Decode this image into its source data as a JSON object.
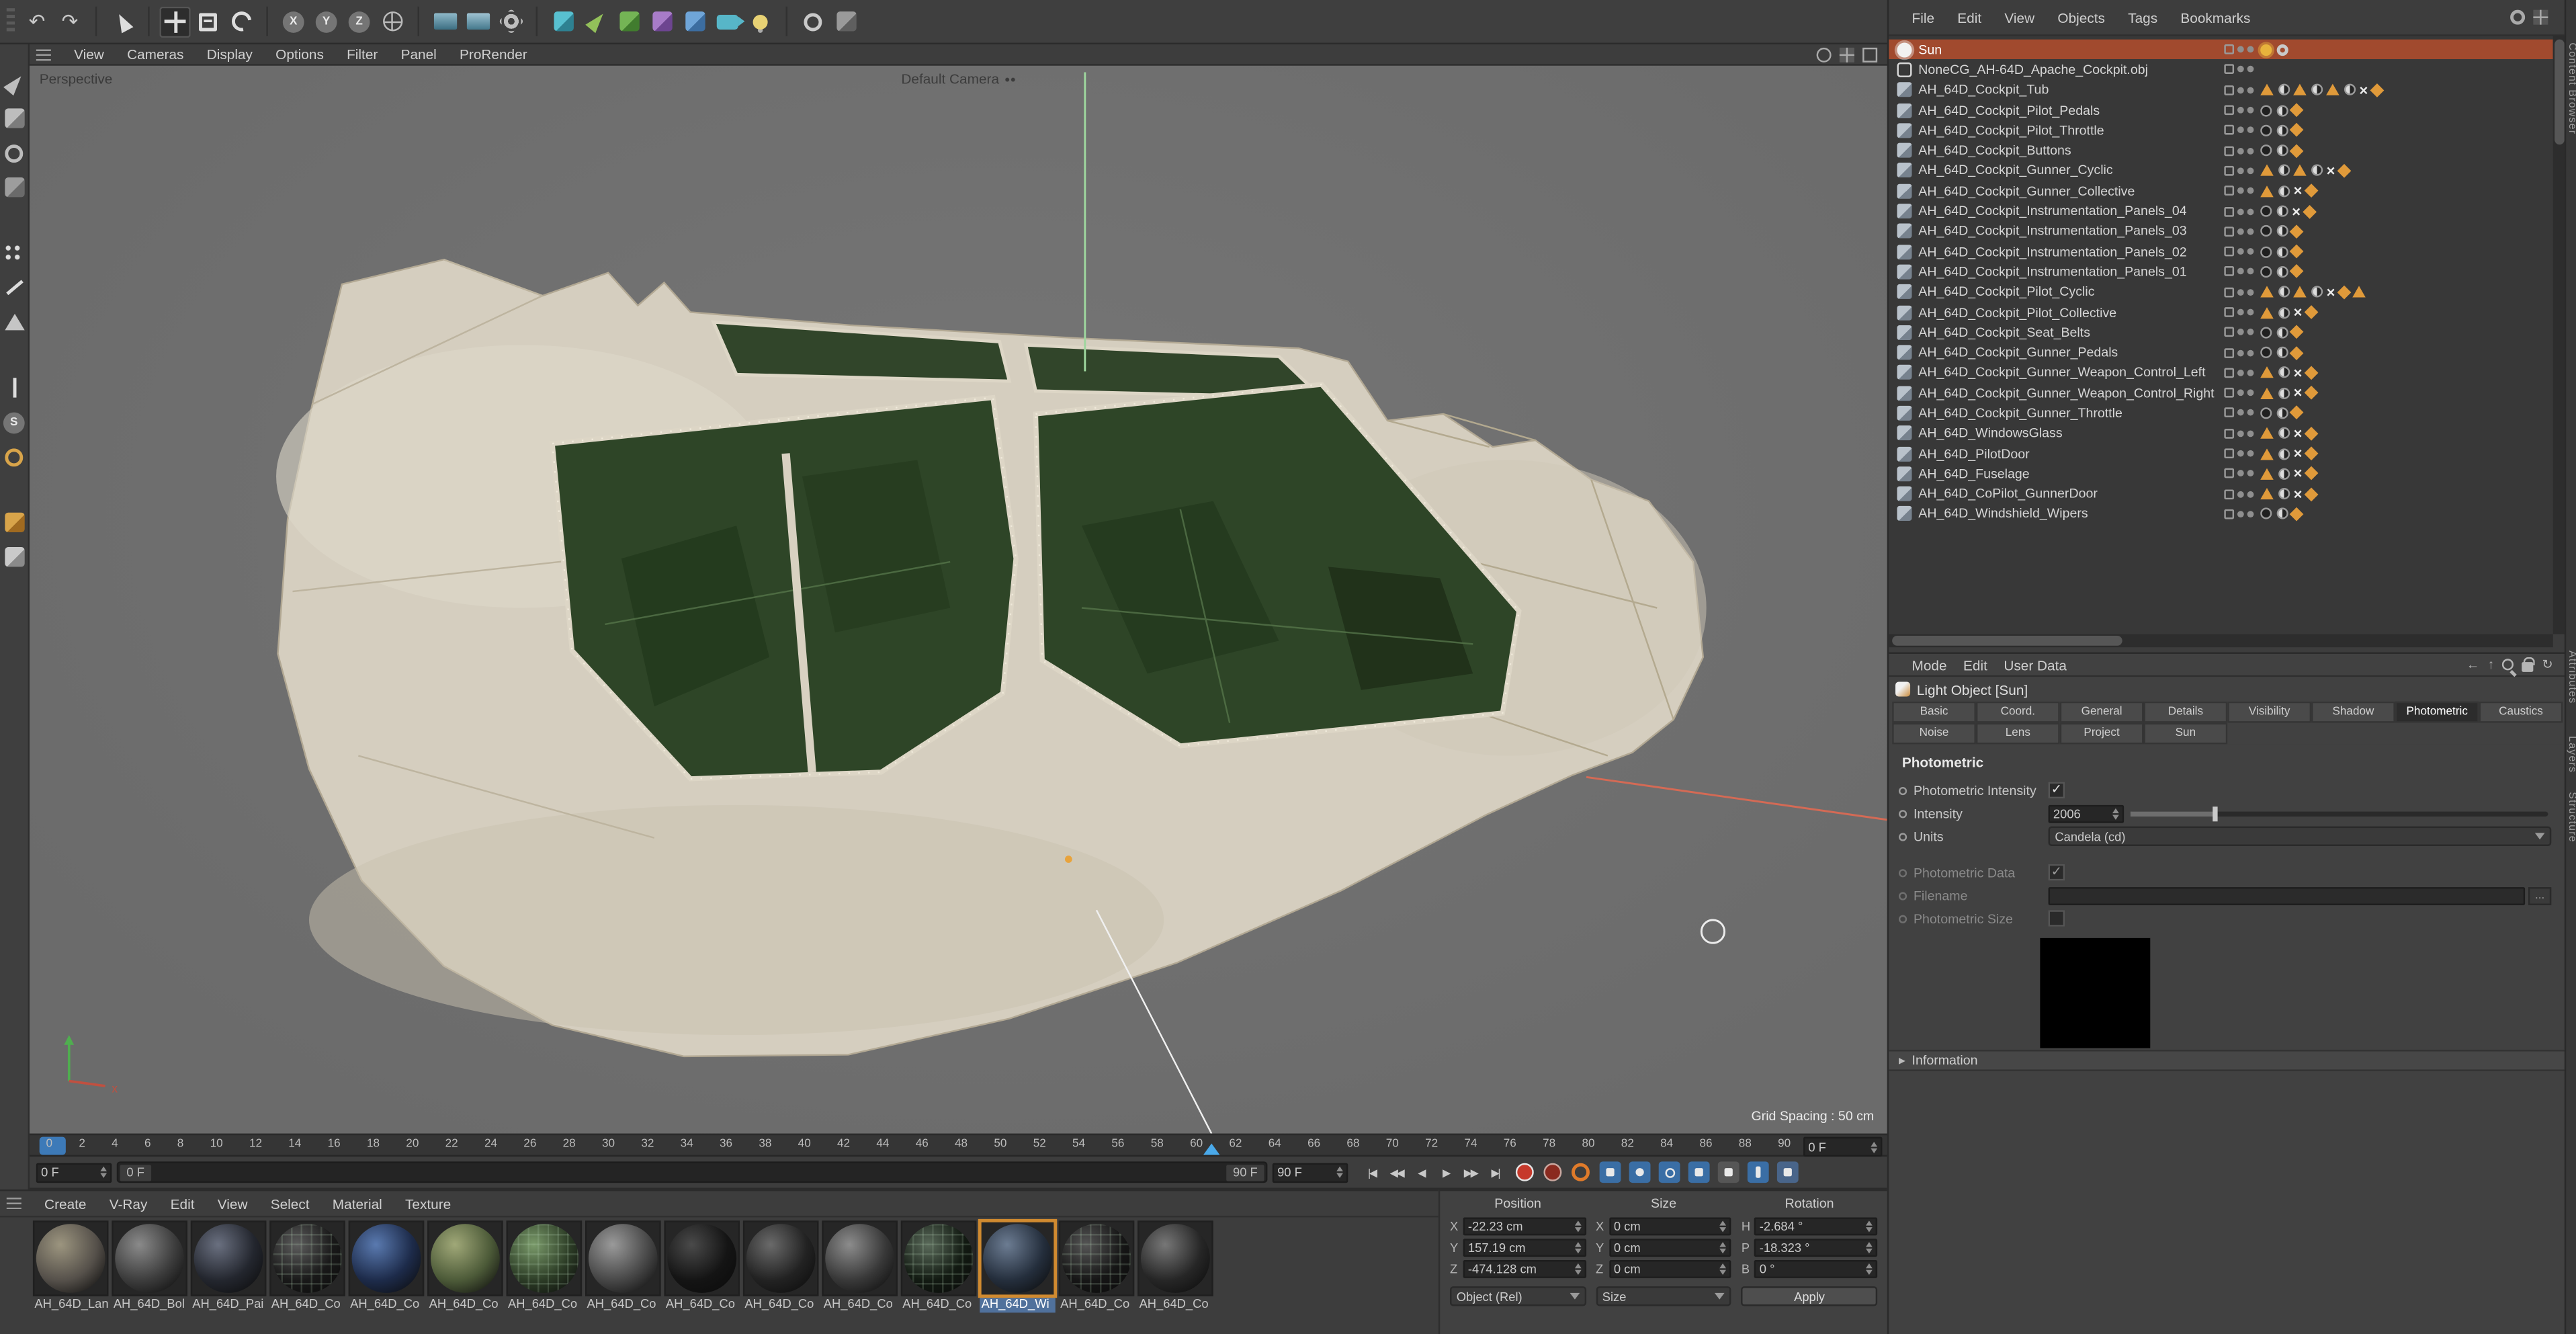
{
  "toolbar": {
    "icons": [
      {
        "name": "undo-icon",
        "type": "glyph",
        "glyph": "↶"
      },
      {
        "name": "redo-icon",
        "type": "glyph",
        "glyph": "↷"
      },
      {
        "sep": true
      },
      {
        "name": "live-selection-icon",
        "type": "cursor"
      },
      {
        "sep": true
      },
      {
        "name": "move-tool-icon",
        "type": "move",
        "active": true
      },
      {
        "name": "scale-tool-icon",
        "type": "scale"
      },
      {
        "name": "rotate-tool-icon",
        "type": "rotate"
      },
      {
        "sep": true
      },
      {
        "name": "x-axis-lock-icon",
        "type": "axis",
        "glyph": "X"
      },
      {
        "name": "y-axis-lock-icon",
        "type": "axis",
        "glyph": "Y"
      },
      {
        "name": "z-axis-lock-icon",
        "type": "axis",
        "glyph": "Z"
      },
      {
        "name": "coordinate-system-icon",
        "type": "coord"
      },
      {
        "sep": true
      },
      {
        "name": "render-view-icon",
        "type": "render",
        "c1": "#8fb9c9",
        "c2": "#3c6e82"
      },
      {
        "name": "render-picture-viewer-icon",
        "type": "render",
        "c1": "#9fc3d2",
        "c2": "#44788c"
      },
      {
        "name": "render-settings-icon",
        "type": "gear"
      },
      {
        "sep": true
      },
      {
        "name": "add-cube-icon",
        "type": "cube",
        "c1": "#58c0d0",
        "c2": "#2e8191"
      },
      {
        "name": "add-spline-icon",
        "type": "pen",
        "c1": "#93c05a"
      },
      {
        "name": "add-generator-icon",
        "type": "cube",
        "c1": "#74b455",
        "c2": "#417c2e"
      },
      {
        "name": "add-deformer-icon",
        "type": "cube",
        "c1": "#a87cc8",
        "c2": "#6d4590"
      },
      {
        "name": "add-environment-icon",
        "type": "cube",
        "c1": "#6fa5d8",
        "c2": "#3c6da0"
      },
      {
        "name": "add-camera-icon",
        "type": "cam",
        "c1": "#57b6c8"
      },
      {
        "name": "add-light-icon",
        "type": "bulb",
        "c1": "#e8d274"
      },
      {
        "sep": true
      },
      {
        "name": "snap-icon",
        "type": "ring",
        "c1": "#c9c9c9"
      },
      {
        "name": "workplane-icon",
        "type": "cube",
        "c1": "#9a9a9a",
        "c2": "#5f5f5f"
      }
    ]
  },
  "left_toolbar": {
    "icons": [
      {
        "name": "make-editable-icon",
        "type": "pen",
        "c1": "#bdbdbd"
      },
      {
        "name": "model-mode-icon",
        "type": "cube",
        "c1": "#bdbdbd",
        "c2": "#7c7c7c"
      },
      {
        "name": "texture-mode-icon",
        "type": "ring",
        "c1": "#bdbdbd"
      },
      {
        "name": "workplane-mode-icon",
        "type": "cube",
        "c1": "#9d9d9d",
        "c2": "#6a6a6a"
      },
      {
        "gap": true
      },
      {
        "name": "points-mode-icon",
        "type": "dots"
      },
      {
        "name": "edges-mode-icon",
        "type": "edge"
      },
      {
        "name": "polygons-mode-icon",
        "type": "poly"
      },
      {
        "gap": true
      },
      {
        "name": "enable-axis-icon",
        "type": "axisArrow"
      },
      {
        "name": "sds-weight-icon",
        "type": "axis",
        "glyph": "S"
      },
      {
        "name": "snap-toggle-icon",
        "type": "ring",
        "c1": "#d8a44a"
      },
      {
        "gap": true
      },
      {
        "name": "locked-workplane-icon",
        "type": "cube",
        "c1": "#d8a44a",
        "c2": "#a06a20"
      },
      {
        "name": "quantize-icon",
        "type": "cube",
        "c1": "#c9c9c9",
        "c2": "#8a8a8a"
      }
    ]
  },
  "viewport": {
    "label": "Perspective",
    "camera_label": "Default Camera",
    "grid_spacing": "Grid Spacing : 50 cm",
    "menu": [
      "View",
      "Cameras",
      "Display",
      "Options",
      "Filter",
      "Panel",
      "ProRender"
    ]
  },
  "timeline": {
    "ticks": [
      "0",
      "2",
      "4",
      "6",
      "8",
      "10",
      "12",
      "14",
      "16",
      "18",
      "20",
      "22",
      "24",
      "26",
      "28",
      "30",
      "32",
      "34",
      "36",
      "38",
      "40",
      "42",
      "44",
      "46",
      "48",
      "50",
      "52",
      "54",
      "56",
      "58",
      "60",
      "62",
      "64",
      "66",
      "68",
      "70",
      "72",
      "74",
      "76",
      "78",
      "80",
      "82",
      "84",
      "86",
      "88",
      "90"
    ],
    "ruler_current": "0 F",
    "current": "0 F",
    "range_start": "0 F",
    "range_end": "90 F",
    "end": "90 F",
    "transport_buttons": [
      {
        "name": "goto-start-button",
        "glyph": "|◀"
      },
      {
        "name": "prev-key-button",
        "glyph": "◀◀"
      },
      {
        "name": "prev-frame-button",
        "glyph": "◀"
      },
      {
        "name": "play-button",
        "glyph": "▶"
      },
      {
        "name": "next-key-button",
        "glyph": "▶▶"
      },
      {
        "name": "goto-end-button",
        "glyph": "▶|"
      }
    ]
  },
  "materials": {
    "menu": [
      "Create",
      "V-Ray",
      "Edit",
      "View",
      "Select",
      "Material",
      "Texture"
    ],
    "items": [
      {
        "label": "AH_64D_Lan",
        "hi": "#9c957f",
        "base": "#55504a"
      },
      {
        "label": "AH_64D_Bol",
        "hi": "#8a8a8a",
        "base": "#3c3c3c"
      },
      {
        "label": "AH_64D_Pai",
        "hi": "#6a7080",
        "base": "#23262e"
      },
      {
        "label": "AH_64D_Co",
        "hi": "#5c5c5c",
        "base": "#191919",
        "grid": true
      },
      {
        "label": "AH_64D_Co",
        "hi": "#5a7ab0",
        "base": "#1d2b4a"
      },
      {
        "label": "AH_64D_Co",
        "hi": "#a0a878",
        "base": "#4c5a38"
      },
      {
        "label": "AH_64D_Co",
        "hi": "#7a9a6a",
        "base": "#2c3c26",
        "grid": true
      },
      {
        "label": "AH_64D_Co",
        "hi": "#9a9a9a",
        "base": "#474747"
      },
      {
        "label": "AH_64D_Co",
        "hi": "#4a4a4a",
        "base": "#141414"
      },
      {
        "label": "AH_64D_Co",
        "hi": "#6a6a6a",
        "base": "#222222"
      },
      {
        "label": "AH_64D_Co",
        "hi": "#8c8c8c",
        "base": "#383838"
      },
      {
        "label": "AH_64D_Co",
        "hi": "#5a6a5a",
        "base": "#121a12",
        "grid": true
      },
      {
        "label": "AH_64D_Wi",
        "hi": "#6c7c92",
        "base": "#242e3c",
        "selected": true
      },
      {
        "label": "AH_64D_Co",
        "hi": "#555555",
        "base": "#161616",
        "grid": true
      },
      {
        "label": "AH_64D_Co",
        "hi": "#777777",
        "base": "#262626"
      }
    ]
  },
  "coordinates": {
    "columns": [
      {
        "header": "Position",
        "rows": [
          {
            "axis": "X",
            "value": "-22.23 cm"
          },
          {
            "axis": "Y",
            "value": "157.19 cm"
          },
          {
            "axis": "Z",
            "value": "-474.128 cm"
          }
        ],
        "footer": {
          "type": "dropdown",
          "label": "Object (Rel)"
        }
      },
      {
        "header": "Size",
        "rows": [
          {
            "axis": "X",
            "value": "0 cm"
          },
          {
            "axis": "Y",
            "value": "0 cm"
          },
          {
            "axis": "Z",
            "value": "0 cm"
          }
        ],
        "footer": {
          "type": "dropdown",
          "label": "Size"
        }
      },
      {
        "header": "Rotation",
        "rows": [
          {
            "axis": "H",
            "value": "-2.684 °"
          },
          {
            "axis": "P",
            "value": "-18.323 °"
          },
          {
            "axis": "B",
            "value": "0 °"
          }
        ],
        "footer": {
          "type": "button",
          "label": "Apply"
        }
      }
    ]
  },
  "object_manager": {
    "menu": [
      "File",
      "Edit",
      "View",
      "Objects",
      "Tags",
      "Bookmarks"
    ],
    "rows": [
      {
        "name": "Sun",
        "icon": "light",
        "selected": true,
        "tags": [
          "sun",
          "gear"
        ]
      },
      {
        "name": "NoneCG_AH-64D_Apache_Cockpit.obj",
        "icon": "null",
        "tags": []
      },
      {
        "name": "AH_64D_Cockpit_Tub",
        "icon": "mesh",
        "tags": [
          "tri",
          "half",
          "tri",
          "half",
          "tri",
          "half",
          "x",
          "star"
        ]
      },
      {
        "name": "AH_64D_Cockpit_Pilot_Pedals",
        "icon": "mesh",
        "tags": [
          "circle",
          "half",
          "star"
        ]
      },
      {
        "name": "AH_64D_Cockpit_Pilot_Throttle",
        "icon": "mesh",
        "tags": [
          "circle",
          "half",
          "star"
        ]
      },
      {
        "name": "AH_64D_Cockpit_Buttons",
        "icon": "mesh",
        "tags": [
          "circle",
          "half",
          "star"
        ]
      },
      {
        "name": "AH_64D_Cockpit_Gunner_Cyclic",
        "icon": "mesh",
        "tags": [
          "tri",
          "half",
          "tri",
          "half",
          "x",
          "star"
        ]
      },
      {
        "name": "AH_64D_Cockpit_Gunner_Collective",
        "icon": "mesh",
        "tags": [
          "tri",
          "half",
          "x",
          "star"
        ]
      },
      {
        "name": "AH_64D_Cockpit_Instrumentation_Panels_04",
        "icon": "mesh",
        "tags": [
          "circle",
          "half",
          "x",
          "star"
        ]
      },
      {
        "name": "AH_64D_Cockpit_Instrumentation_Panels_03",
        "icon": "mesh",
        "tags": [
          "circle",
          "half",
          "star"
        ]
      },
      {
        "name": "AH_64D_Cockpit_Instrumentation_Panels_02",
        "icon": "mesh",
        "tags": [
          "circle",
          "half",
          "star"
        ]
      },
      {
        "name": "AH_64D_Cockpit_Instrumentation_Panels_01",
        "icon": "mesh",
        "tags": [
          "circle",
          "half",
          "star"
        ]
      },
      {
        "name": "AH_64D_Cockpit_Pilot_Cyclic",
        "icon": "mesh",
        "tags": [
          "tri",
          "half",
          "tri",
          "half",
          "x",
          "star",
          "tri"
        ]
      },
      {
        "name": "AH_64D_Cockpit_Pilot_Collective",
        "icon": "mesh",
        "tags": [
          "tri",
          "half",
          "x",
          "star"
        ]
      },
      {
        "name": "AH_64D_Cockpit_Seat_Belts",
        "icon": "mesh",
        "tags": [
          "circle",
          "half",
          "star"
        ]
      },
      {
        "name": "AH_64D_Cockpit_Gunner_Pedals",
        "icon": "mesh",
        "tags": [
          "circle",
          "half",
          "star"
        ]
      },
      {
        "name": "AH_64D_Cockpit_Gunner_Weapon_Control_Left",
        "icon": "mesh",
        "tags": [
          "tri",
          "half",
          "x",
          "star"
        ]
      },
      {
        "name": "AH_64D_Cockpit_Gunner_Weapon_Control_Right",
        "icon": "mesh",
        "tags": [
          "tri",
          "half",
          "x",
          "star"
        ]
      },
      {
        "name": "AH_64D_Cockpit_Gunner_Throttle",
        "icon": "mesh",
        "tags": [
          "circle",
          "half",
          "star"
        ]
      },
      {
        "name": "AH_64D_WindowsGlass",
        "icon": "mesh",
        "tags": [
          "tri",
          "half",
          "x",
          "star"
        ]
      },
      {
        "name": "AH_64D_PilotDoor",
        "icon": "mesh",
        "tags": [
          "tri",
          "half",
          "x",
          "star"
        ]
      },
      {
        "name": "AH_64D_Fuselage",
        "icon": "mesh",
        "tags": [
          "tri",
          "half",
          "x",
          "star"
        ]
      },
      {
        "name": "AH_64D_CoPilot_GunnerDoor",
        "icon": "mesh",
        "tags": [
          "tri",
          "half",
          "x",
          "star"
        ]
      },
      {
        "name": "AH_64D_Windshield_Wipers",
        "icon": "mesh",
        "tags": [
          "circle",
          "half",
          "star"
        ]
      }
    ]
  },
  "attribute_manager": {
    "menu": [
      "Mode",
      "Edit",
      "User Data"
    ],
    "title": "Light Object [Sun]",
    "tabs_row1": [
      {
        "label": "Basic"
      },
      {
        "label": "Coord."
      },
      {
        "label": "General"
      },
      {
        "label": "Details"
      },
      {
        "label": "Visibility"
      },
      {
        "label": "Shadow"
      },
      {
        "label": "Photometric",
        "active": true
      },
      {
        "label": "Caustics"
      }
    ],
    "tabs_row2": [
      "Noise",
      "Lens",
      "Project",
      "Sun"
    ],
    "section_title": "Photometric",
    "fields": {
      "photometric_intensity_label": "Photometric Intensity",
      "intensity_label": "Intensity",
      "intensity_value": "2006",
      "units_label": "Units",
      "units_value": "Candela (cd)",
      "photometric_data_label": "Photometric Data",
      "filename_label": "Filename",
      "filename_browse": "...",
      "photometric_size_label": "Photometric Size",
      "information_label": "Information"
    }
  },
  "side_tabs": [
    "Content Browser",
    "Attributes",
    "Layers",
    "Structure"
  ]
}
